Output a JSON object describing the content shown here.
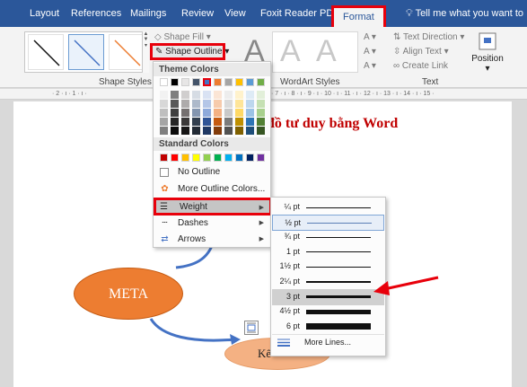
{
  "ribbon_tabs": {
    "layout": "Layout",
    "references": "References",
    "mailings": "Mailings",
    "review": "Review",
    "view": "View",
    "foxit": "Foxit Reader PDF",
    "format": "Format",
    "tell": "Tell me what you want to"
  },
  "ribbon": {
    "shape_fill": "Shape Fill",
    "shape_outline": "Shape Outline",
    "shape_styles": "Shape Styles",
    "wordart_styles": "WordArt Styles",
    "wordart_letter": "A",
    "text_direction": "Text Direction",
    "align_text": "Align Text",
    "create_link": "Create Link",
    "text_group": "Text",
    "position": "Position"
  },
  "ruler": {
    "left_marks": "· 2 · ı · 1 · ı ·",
    "right_marks": "· 7 · ı · 8 · ı · 9 · ı · 10 · ı · 11 · ı · 12 · ı · 13 · ı · 14 · ı · 15 ·"
  },
  "document": {
    "title": "đồ tư duy bằng Word",
    "meta_label": "META",
    "ke_label": "Kế"
  },
  "outline_menu": {
    "theme_colors": "Theme Colors",
    "standard_colors": "Standard Colors",
    "no_outline": "No Outline",
    "more_colors": "More Outline Colors...",
    "weight": "Weight",
    "dashes": "Dashes",
    "arrows": "Arrows",
    "theme_top_row": [
      "#ffffff",
      "#000000",
      "#e7e6e6",
      "#44546a",
      "#4472c4",
      "#ed7d31",
      "#a5a5a5",
      "#ffc000",
      "#5b9bd5",
      "#70ad47"
    ],
    "theme_shades": [
      [
        "#f2f2f2",
        "#7f7f7f",
        "#d0cece",
        "#d6dce4",
        "#d9e2f3",
        "#fbe5d5",
        "#ededed",
        "#fff2cc",
        "#deebf6",
        "#e2efd9"
      ],
      [
        "#d8d8d8",
        "#595959",
        "#aeabab",
        "#adb9ca",
        "#b4c6e7",
        "#f7cbac",
        "#dbdbdb",
        "#fee599",
        "#bdd7ee",
        "#c5e0b3"
      ],
      [
        "#bfbfbf",
        "#3f3f3f",
        "#757070",
        "#8496b0",
        "#8eaadb",
        "#f4b183",
        "#c9c9c9",
        "#ffd965",
        "#9cc3e5",
        "#a8d08d"
      ],
      [
        "#a5a5a5",
        "#262626",
        "#3a3838",
        "#323f4f",
        "#2f5496",
        "#c55a11",
        "#7b7b7b",
        "#bf9000",
        "#2e75b5",
        "#538135"
      ],
      [
        "#7f7f7f",
        "#0c0c0c",
        "#171616",
        "#222a35",
        "#1f3864",
        "#833c0b",
        "#525252",
        "#7f6000",
        "#1e4e79",
        "#375623"
      ]
    ],
    "standard": [
      "#c00000",
      "#ff0000",
      "#ffc000",
      "#ffff00",
      "#92d050",
      "#00b050",
      "#00b0f0",
      "#0070c0",
      "#002060",
      "#7030a0"
    ]
  },
  "weight_menu": {
    "items": [
      {
        "label": "¼ pt",
        "points": 0.25
      },
      {
        "label": "½ pt",
        "points": 0.5
      },
      {
        "label": "¾ pt",
        "points": 0.75
      },
      {
        "label": "1 pt",
        "points": 1
      },
      {
        "label": "1½ pt",
        "points": 1.5
      },
      {
        "label": "2¼ pt",
        "points": 2.25
      },
      {
        "label": "3 pt",
        "points": 3
      },
      {
        "label": "4½ pt",
        "points": 4.5
      },
      {
        "label": "6 pt",
        "points": 6
      }
    ],
    "selected": "3 pt",
    "current": "½ pt",
    "more_lines": "More Lines..."
  },
  "colors": {
    "accent": "#2b579a",
    "highlight_red": "#e8000b",
    "meta_fill": "#ed7d31",
    "ke_fill": "#f4b183",
    "title_red": "#c00000"
  }
}
